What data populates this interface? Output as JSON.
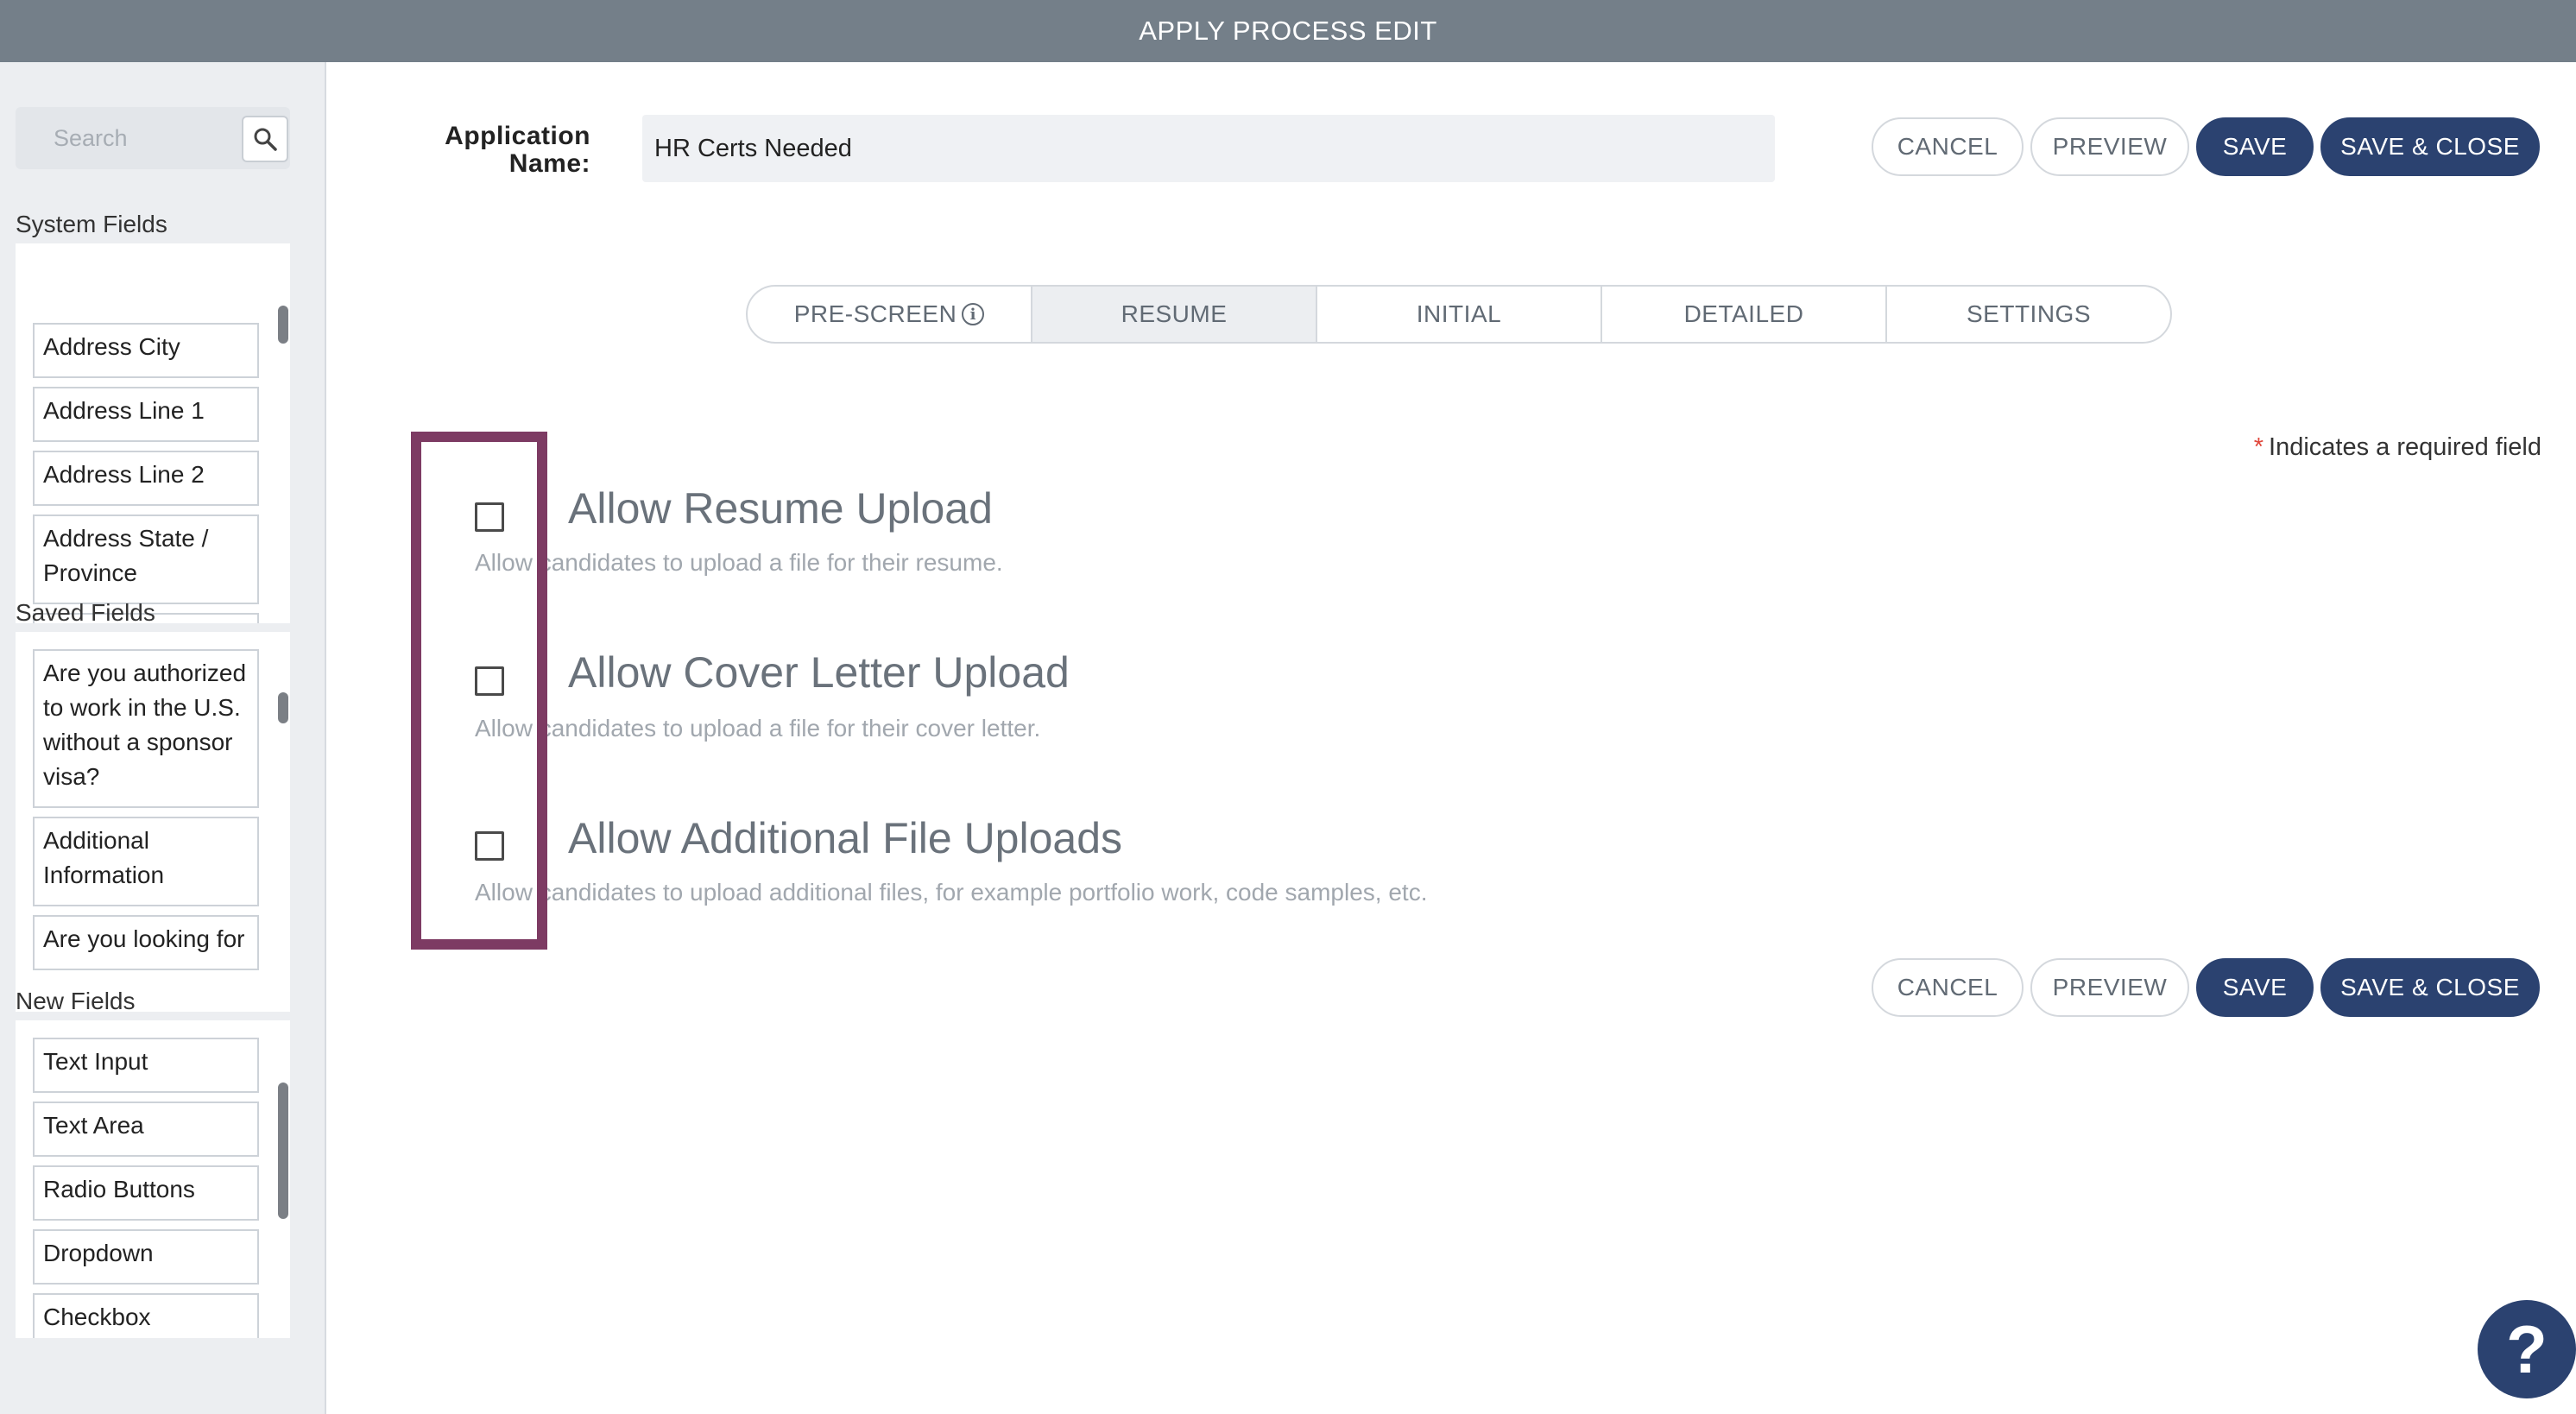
{
  "header": {
    "title": "APPLY PROCESS EDIT"
  },
  "sidebar": {
    "search": {
      "placeholder": "Search"
    },
    "system_fields": {
      "title": "System Fields",
      "items": [
        "Address City",
        "Address Line 1",
        "Address Line 2",
        "Address State / Province"
      ]
    },
    "saved_fields": {
      "title": "Saved Fields",
      "items": [
        "Are you authorized to work in the U.S. without a sponsor visa?",
        "Additional Information",
        "Are you looking for"
      ]
    },
    "new_fields": {
      "title": "New Fields",
      "items": [
        "Text Input",
        "Text Area",
        "Radio Buttons",
        "Dropdown",
        "Checkbox"
      ]
    }
  },
  "form": {
    "app_name_label": "Application Name:",
    "app_name_value": "HR Certs Needed"
  },
  "actions": {
    "cancel": "CANCEL",
    "preview": "PREVIEW",
    "save": "SAVE",
    "save_close": "SAVE & CLOSE"
  },
  "tabs": [
    {
      "label": "PRE-SCREEN",
      "info": "i",
      "active": false
    },
    {
      "label": "RESUME",
      "active": true
    },
    {
      "label": "INITIAL",
      "active": false
    },
    {
      "label": "DETAILED",
      "active": false
    },
    {
      "label": "SETTINGS",
      "active": false
    }
  ],
  "required_note": {
    "star": "*",
    "text": "Indicates a required field"
  },
  "options": [
    {
      "title": "Allow Resume Upload",
      "description": "Allow candidates to upload a file for their resume.",
      "checked": false
    },
    {
      "title": "Allow Cover Letter Upload",
      "description": "Allow candidates to upload a file for their cover letter.",
      "checked": false
    },
    {
      "title": "Allow Additional File Uploads",
      "description": "Allow candidates to upload additional files, for example portfolio work, code samples, etc.",
      "checked": false
    }
  ],
  "help": {
    "label": "?"
  },
  "colors": {
    "header": "#747f89",
    "primary": "#2b4270",
    "highlight": "#7d3b63"
  }
}
